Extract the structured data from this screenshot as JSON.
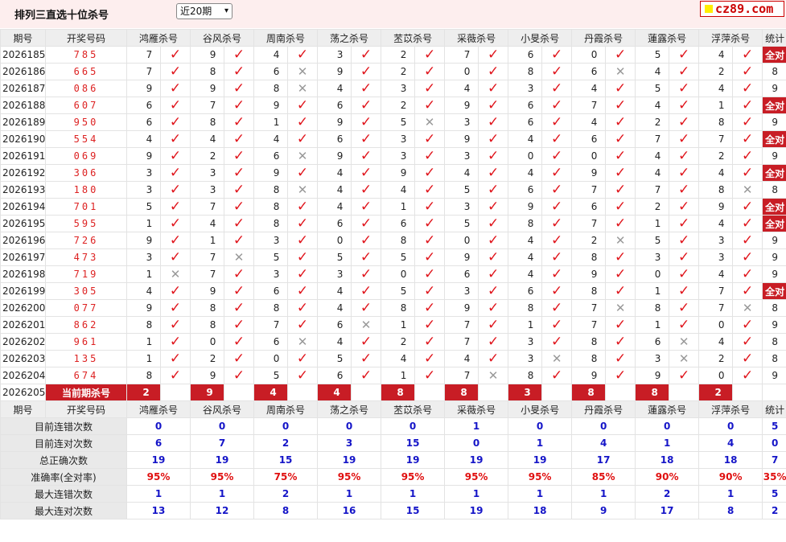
{
  "header": {
    "title": "排列三直选十位杀号",
    "period_select": "近20期",
    "logo": "cz89.com"
  },
  "columns": {
    "issue": "期号",
    "draw": "开奖号码",
    "experts": [
      "鸿雁杀号",
      "谷风杀号",
      "周南杀号",
      "荡之杀号",
      "苤苡杀号",
      "采薇杀号",
      "小旻杀号",
      "丹霞杀号",
      "蓮露杀号",
      "浮萍杀号"
    ],
    "stat": "统计"
  },
  "rows": [
    {
      "issue": "2026185",
      "draw": "785",
      "picks": [
        [
          7,
          1
        ],
        [
          9,
          1
        ],
        [
          4,
          1
        ],
        [
          3,
          1
        ],
        [
          2,
          1
        ],
        [
          7,
          1
        ],
        [
          6,
          1
        ],
        [
          0,
          1
        ],
        [
          5,
          1
        ],
        [
          4,
          1
        ]
      ],
      "stat": "全对"
    },
    {
      "issue": "2026186",
      "draw": "665",
      "picks": [
        [
          7,
          1
        ],
        [
          8,
          1
        ],
        [
          6,
          0
        ],
        [
          9,
          1
        ],
        [
          2,
          1
        ],
        [
          0,
          1
        ],
        [
          8,
          1
        ],
        [
          6,
          0
        ],
        [
          4,
          1
        ],
        [
          2,
          1
        ]
      ],
      "stat": "8"
    },
    {
      "issue": "2026187",
      "draw": "086",
      "picks": [
        [
          9,
          1
        ],
        [
          9,
          1
        ],
        [
          8,
          0
        ],
        [
          4,
          1
        ],
        [
          3,
          1
        ],
        [
          4,
          1
        ],
        [
          3,
          1
        ],
        [
          4,
          1
        ],
        [
          5,
          1
        ],
        [
          4,
          1
        ]
      ],
      "stat": "9"
    },
    {
      "issue": "2026188",
      "draw": "607",
      "picks": [
        [
          6,
          1
        ],
        [
          7,
          1
        ],
        [
          9,
          1
        ],
        [
          6,
          1
        ],
        [
          2,
          1
        ],
        [
          9,
          1
        ],
        [
          6,
          1
        ],
        [
          7,
          1
        ],
        [
          4,
          1
        ],
        [
          1,
          1
        ]
      ],
      "stat": "全对"
    },
    {
      "issue": "2026189",
      "draw": "950",
      "picks": [
        [
          6,
          1
        ],
        [
          8,
          1
        ],
        [
          1,
          1
        ],
        [
          9,
          1
        ],
        [
          5,
          0
        ],
        [
          3,
          1
        ],
        [
          6,
          1
        ],
        [
          4,
          1
        ],
        [
          2,
          1
        ],
        [
          8,
          1
        ]
      ],
      "stat": "9"
    },
    {
      "issue": "2026190",
      "draw": "554",
      "picks": [
        [
          4,
          1
        ],
        [
          4,
          1
        ],
        [
          4,
          1
        ],
        [
          6,
          1
        ],
        [
          3,
          1
        ],
        [
          9,
          1
        ],
        [
          4,
          1
        ],
        [
          6,
          1
        ],
        [
          7,
          1
        ],
        [
          7,
          1
        ]
      ],
      "stat": "全对"
    },
    {
      "issue": "2026191",
      "draw": "069",
      "picks": [
        [
          9,
          1
        ],
        [
          2,
          1
        ],
        [
          6,
          0
        ],
        [
          9,
          1
        ],
        [
          3,
          1
        ],
        [
          3,
          1
        ],
        [
          0,
          1
        ],
        [
          0,
          1
        ],
        [
          4,
          1
        ],
        [
          2,
          1
        ]
      ],
      "stat": "9"
    },
    {
      "issue": "2026192",
      "draw": "306",
      "picks": [
        [
          3,
          1
        ],
        [
          3,
          1
        ],
        [
          9,
          1
        ],
        [
          4,
          1
        ],
        [
          9,
          1
        ],
        [
          4,
          1
        ],
        [
          4,
          1
        ],
        [
          9,
          1
        ],
        [
          4,
          1
        ],
        [
          4,
          1
        ]
      ],
      "stat": "全对"
    },
    {
      "issue": "2026193",
      "draw": "180",
      "picks": [
        [
          3,
          1
        ],
        [
          3,
          1
        ],
        [
          8,
          0
        ],
        [
          4,
          1
        ],
        [
          4,
          1
        ],
        [
          5,
          1
        ],
        [
          6,
          1
        ],
        [
          7,
          1
        ],
        [
          7,
          1
        ],
        [
          8,
          0
        ]
      ],
      "stat": "8"
    },
    {
      "issue": "2026194",
      "draw": "701",
      "picks": [
        [
          5,
          1
        ],
        [
          7,
          1
        ],
        [
          8,
          1
        ],
        [
          4,
          1
        ],
        [
          1,
          1
        ],
        [
          3,
          1
        ],
        [
          9,
          1
        ],
        [
          6,
          1
        ],
        [
          2,
          1
        ],
        [
          9,
          1
        ]
      ],
      "stat": "全对"
    },
    {
      "issue": "2026195",
      "draw": "595",
      "picks": [
        [
          1,
          1
        ],
        [
          4,
          1
        ],
        [
          8,
          1
        ],
        [
          6,
          1
        ],
        [
          6,
          1
        ],
        [
          5,
          1
        ],
        [
          8,
          1
        ],
        [
          7,
          1
        ],
        [
          1,
          1
        ],
        [
          4,
          1
        ]
      ],
      "stat": "全对"
    },
    {
      "issue": "2026196",
      "draw": "726",
      "picks": [
        [
          9,
          1
        ],
        [
          1,
          1
        ],
        [
          3,
          1
        ],
        [
          0,
          1
        ],
        [
          8,
          1
        ],
        [
          0,
          1
        ],
        [
          4,
          1
        ],
        [
          2,
          0
        ],
        [
          5,
          1
        ],
        [
          3,
          1
        ]
      ],
      "stat": "9"
    },
    {
      "issue": "2026197",
      "draw": "473",
      "picks": [
        [
          3,
          1
        ],
        [
          7,
          0
        ],
        [
          5,
          1
        ],
        [
          5,
          1
        ],
        [
          5,
          1
        ],
        [
          9,
          1
        ],
        [
          4,
          1
        ],
        [
          8,
          1
        ],
        [
          3,
          1
        ],
        [
          3,
          1
        ]
      ],
      "stat": "9"
    },
    {
      "issue": "2026198",
      "draw": "719",
      "picks": [
        [
          1,
          0
        ],
        [
          7,
          1
        ],
        [
          3,
          1
        ],
        [
          3,
          1
        ],
        [
          0,
          1
        ],
        [
          6,
          1
        ],
        [
          4,
          1
        ],
        [
          9,
          1
        ],
        [
          0,
          1
        ],
        [
          4,
          1
        ]
      ],
      "stat": "9"
    },
    {
      "issue": "2026199",
      "draw": "305",
      "picks": [
        [
          4,
          1
        ],
        [
          9,
          1
        ],
        [
          6,
          1
        ],
        [
          4,
          1
        ],
        [
          5,
          1
        ],
        [
          3,
          1
        ],
        [
          6,
          1
        ],
        [
          8,
          1
        ],
        [
          1,
          1
        ],
        [
          7,
          1
        ]
      ],
      "stat": "全对"
    },
    {
      "issue": "2026200",
      "draw": "077",
      "picks": [
        [
          9,
          1
        ],
        [
          8,
          1
        ],
        [
          8,
          1
        ],
        [
          4,
          1
        ],
        [
          8,
          1
        ],
        [
          9,
          1
        ],
        [
          8,
          1
        ],
        [
          7,
          0
        ],
        [
          8,
          1
        ],
        [
          7,
          0
        ]
      ],
      "stat": "8"
    },
    {
      "issue": "2026201",
      "draw": "862",
      "picks": [
        [
          8,
          1
        ],
        [
          8,
          1
        ],
        [
          7,
          1
        ],
        [
          6,
          0
        ],
        [
          1,
          1
        ],
        [
          7,
          1
        ],
        [
          1,
          1
        ],
        [
          7,
          1
        ],
        [
          1,
          1
        ],
        [
          0,
          1
        ]
      ],
      "stat": "9"
    },
    {
      "issue": "2026202",
      "draw": "961",
      "picks": [
        [
          1,
          1
        ],
        [
          0,
          1
        ],
        [
          6,
          0
        ],
        [
          4,
          1
        ],
        [
          2,
          1
        ],
        [
          7,
          1
        ],
        [
          3,
          1
        ],
        [
          8,
          1
        ],
        [
          6,
          0
        ],
        [
          4,
          1
        ]
      ],
      "stat": "8"
    },
    {
      "issue": "2026203",
      "draw": "135",
      "picks": [
        [
          1,
          1
        ],
        [
          2,
          1
        ],
        [
          0,
          1
        ],
        [
          5,
          1
        ],
        [
          4,
          1
        ],
        [
          4,
          1
        ],
        [
          3,
          0
        ],
        [
          8,
          1
        ],
        [
          3,
          0
        ],
        [
          2,
          1
        ]
      ],
      "stat": "8"
    },
    {
      "issue": "2026204",
      "draw": "674",
      "picks": [
        [
          8,
          1
        ],
        [
          9,
          1
        ],
        [
          5,
          1
        ],
        [
          6,
          1
        ],
        [
          1,
          1
        ],
        [
          7,
          0
        ],
        [
          8,
          1
        ],
        [
          9,
          1
        ],
        [
          9,
          1
        ],
        [
          0,
          1
        ]
      ],
      "stat": "9"
    }
  ],
  "current": {
    "issue": "2026205",
    "label": "当前期杀号",
    "picks": [
      "2",
      "9",
      "4",
      "4",
      "8",
      "8",
      "3",
      "8",
      "8",
      "2"
    ]
  },
  "stats_header": {
    "issue": "期号",
    "draw": "开奖号码",
    "stat": "统计"
  },
  "stats": [
    {
      "label": "目前连错次数",
      "values": [
        "0",
        "0",
        "0",
        "0",
        "0",
        "1",
        "0",
        "0",
        "0",
        "0"
      ],
      "total": "5",
      "red": false
    },
    {
      "label": "目前连对次数",
      "values": [
        "6",
        "7",
        "2",
        "3",
        "15",
        "0",
        "1",
        "4",
        "1",
        "4"
      ],
      "total": "0",
      "red": false
    },
    {
      "label": "总正确次数",
      "values": [
        "19",
        "19",
        "15",
        "19",
        "19",
        "19",
        "19",
        "17",
        "18",
        "18"
      ],
      "total": "7",
      "red": false
    },
    {
      "label": "准确率(全对率)",
      "values": [
        "95%",
        "95%",
        "75%",
        "95%",
        "95%",
        "95%",
        "95%",
        "85%",
        "90%",
        "90%"
      ],
      "total": "35%",
      "red": true
    },
    {
      "label": "最大连错次数",
      "values": [
        "1",
        "1",
        "2",
        "1",
        "1",
        "1",
        "1",
        "1",
        "2",
        "1"
      ],
      "total": "5",
      "red": false
    },
    {
      "label": "最大连对次数",
      "values": [
        "13",
        "12",
        "8",
        "16",
        "15",
        "19",
        "18",
        "9",
        "17",
        "8"
      ],
      "total": "2",
      "red": false
    }
  ],
  "colors": {
    "accent": "#c81d25",
    "hit": "#e0151c",
    "miss": "#999999",
    "stat_blue": "#1515c8",
    "header_bg": "#eeeeee",
    "topbar_bg": "#fdeeee"
  },
  "icons": {
    "hit": "check-icon",
    "miss": "cross-icon"
  }
}
